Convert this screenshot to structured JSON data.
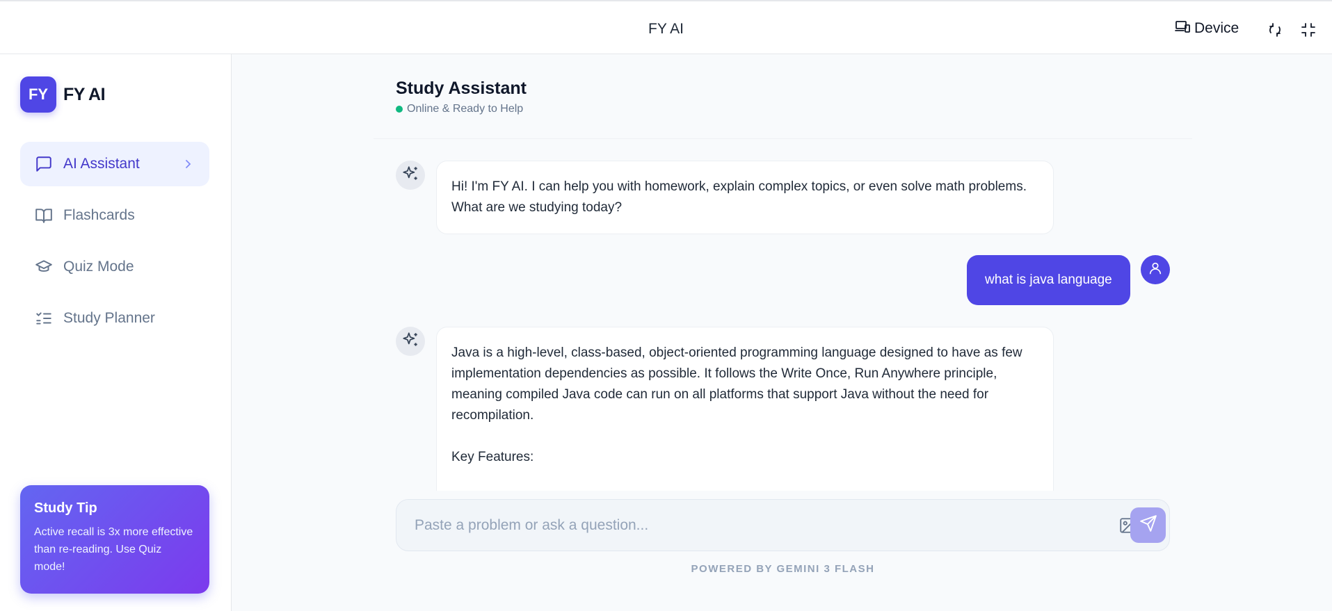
{
  "topbar": {
    "title": "FY AI",
    "device_label": "Device"
  },
  "sidebar": {
    "logo_initials": "FY",
    "logo_text": "FY AI",
    "items": [
      {
        "label": "AI Assistant",
        "active": true,
        "icon": "message-square-icon"
      },
      {
        "label": "Flashcards",
        "active": false,
        "icon": "book-open-icon"
      },
      {
        "label": "Quiz Mode",
        "active": false,
        "icon": "graduation-cap-icon"
      },
      {
        "label": "Study Planner",
        "active": false,
        "icon": "list-checks-icon"
      }
    ],
    "tip": {
      "title": "Study Tip",
      "body": "Active recall is 3x more effective than re-reading. Use Quiz mode!"
    }
  },
  "chat": {
    "title": "Study Assistant",
    "status": "Online & Ready to Help",
    "messages": [
      {
        "role": "assistant",
        "text": "Hi! I'm FY AI. I can help you with homework, explain complex topics, or even solve math problems. What are we studying today?"
      },
      {
        "role": "user",
        "text": "what is java language"
      },
      {
        "role": "assistant",
        "text": "Java is a high-level, class-based, object-oriented programming language designed to have as few implementation dependencies as possible. It follows the Write Once, Run Anywhere principle, meaning compiled Java code can run on all platforms that support Java without the need for recompilation.\n\nKey Features:"
      }
    ],
    "input_placeholder": "Paste a problem or ask a question...",
    "powered_by": "POWERED BY GEMINI 3 FLASH"
  },
  "colors": {
    "accent": "#4f46e5",
    "status_online": "#10b981",
    "tip_gradient_start": "#6366f1",
    "tip_gradient_end": "#7c3aed"
  }
}
